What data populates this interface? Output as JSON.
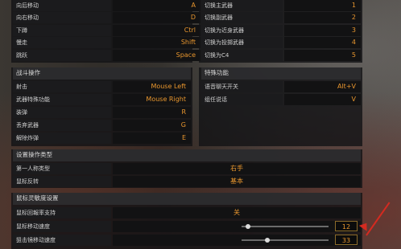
{
  "movement": {
    "rows": [
      {
        "label": "向后移动",
        "key": "A"
      },
      {
        "label": "向右移动",
        "key": "D"
      },
      {
        "label": "下蹲",
        "key": "Ctrl"
      },
      {
        "label": "慢走",
        "key": "Shift"
      },
      {
        "label": "跳跃",
        "key": "Space"
      }
    ]
  },
  "weapon_switch": {
    "rows": [
      {
        "label": "切换主武器",
        "key": "1"
      },
      {
        "label": "切换副武器",
        "key": "2"
      },
      {
        "label": "切换为近身武器",
        "key": "3"
      },
      {
        "label": "切换为投掷武器",
        "key": "4"
      },
      {
        "label": "切换为C4",
        "key": "5"
      }
    ]
  },
  "combat": {
    "title": "战斗操作",
    "rows": [
      {
        "label": "射击",
        "key": "Mouse Left"
      },
      {
        "label": "武器特殊功能",
        "key": "Mouse Right"
      },
      {
        "label": "装弹",
        "key": "R"
      },
      {
        "label": "丢弃武器",
        "key": "G"
      },
      {
        "label": "解除炸弹",
        "key": "E"
      }
    ]
  },
  "special": {
    "title": "特殊功能",
    "rows": [
      {
        "label": "语音聊天开关",
        "key": "Alt+V"
      },
      {
        "label": "组任说话",
        "key": "V"
      }
    ]
  },
  "device_type": {
    "title": "设置操作类型",
    "rows": [
      {
        "label": "第一人称类型",
        "value": "右手"
      },
      {
        "label": "鼠标反转",
        "value": "基本"
      }
    ]
  },
  "mouse_sensitivity": {
    "title": "鼠标灵敏度设置",
    "support_label": "鼠标回報率支持",
    "support_value": "关",
    "sliders": [
      {
        "label": "鼠标移动速度",
        "value": "12",
        "fraction": 0.05
      },
      {
        "label": "狙击镜移动速度",
        "value": "33",
        "fraction": 0.28
      }
    ]
  },
  "colors": {
    "accent": "#e8962e",
    "arrow": "#d42a20"
  }
}
